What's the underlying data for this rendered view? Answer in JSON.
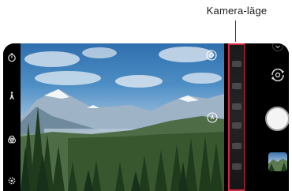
{
  "annotation": {
    "label": "Kamera-läge"
  },
  "colors": {
    "highlight": "#d3263f",
    "shutter": "#f4f4f4"
  },
  "left_toolbar": {
    "icons": [
      "timer-icon",
      "filter-icon",
      "hdr-icon",
      "settings-icon"
    ]
  },
  "viewfinder": {
    "icons": [
      "steady-cam-icon",
      "zoom-icon"
    ]
  },
  "right_toolbar": {
    "icons": [
      "menu-icon",
      "switch-camera-icon",
      "shutter-button",
      "gallery-thumbnail"
    ]
  }
}
